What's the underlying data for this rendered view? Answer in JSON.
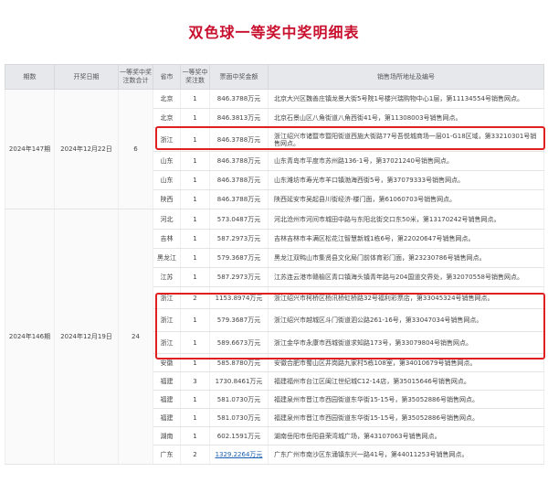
{
  "title": "双色球一等奖中奖明细表",
  "headers": {
    "period": "期数",
    "date": "开奖日期",
    "total": "一等奖中奖注数合计",
    "province": "省市",
    "count": "一等奖中奖注数",
    "amount": "票面中奖金额",
    "address": "销售场所地址及编号"
  },
  "groups": [
    {
      "period": "2024年147期",
      "date": "2024年12月22日",
      "total": "6",
      "rows": [
        {
          "province": "北京",
          "count": "1",
          "amount": "846.3788万元",
          "address": "北京大兴区魏善庄镇龙景大街5号院1号楼兴瑞购物中心1层，第11134554号销售网点。"
        },
        {
          "province": "北京",
          "count": "1",
          "amount": "846.3813万元",
          "address": "北京石景山区八角街道八角西街41号，第11308003号销售网点。"
        },
        {
          "province": "浙江",
          "count": "1",
          "amount": "846.3788万元",
          "address": "浙江绍兴市诸暨市暨阳街道西施大街路77号吾悦城商场一层01-G18区域，第33210301号销售网点。"
        },
        {
          "province": "山东",
          "count": "1",
          "amount": "846.3788万元",
          "address": "山东青岛市平度市苏州路136-1号，第37021240号销售网点。"
        },
        {
          "province": "山东",
          "count": "1",
          "amount": "846.3788万元",
          "address": "山东潍坊市寿光市羊口镇渤海西街5号，第37079333号销售网点。"
        },
        {
          "province": "陕西",
          "count": "1",
          "amount": "846.3788万元",
          "address": "陕西延安市吴起县川街经济-楼门面，第61060703号销售网点。"
        }
      ]
    },
    {
      "period": "2024年146期",
      "date": "2024年12月19日",
      "total": "24",
      "rows": [
        {
          "province": "河北",
          "count": "1",
          "amount": "573.0487万元",
          "address": "河北沧州市河间市城田中路与东阳北街交口东50米，第13170242号销售网点。"
        },
        {
          "province": "吉林",
          "count": "1",
          "amount": "587.2973万元",
          "address": "吉林吉林市丰满区松花江智慧新城1栋6号，第22020647号销售网点。"
        },
        {
          "province": "黑龙江",
          "count": "1",
          "amount": "579.3687万元",
          "address": "黑龙江双鸭山市集贤县文化局门前体育彩门面，第23230786号销售网点。"
        },
        {
          "province": "江苏",
          "count": "1",
          "amount": "587.2973万元",
          "address": "江苏连云港市赣榆区青口镇海头镇青年路与204国道交界处，第32070558号销售网点。"
        },
        {
          "province": "浙江",
          "count": "2",
          "amount": "1153.8974万元",
          "address": "浙江绍兴市柯桥区杨汛桥虹桥路32号福利彩票店，第33045324号销售网点。"
        },
        {
          "province": "浙江",
          "count": "1",
          "amount": "579.3687万元",
          "address": "浙江绍兴市越城区斗门街道泗公路261-16号，第33047034号销售网点。"
        },
        {
          "province": "浙江",
          "count": "1",
          "amount": "589.6673万元",
          "address": "浙江金华市永康市西城街道求知路173号，第33079804号销售网点。"
        },
        {
          "province": "安徽",
          "count": "1",
          "amount": "585.8780万元",
          "address": "安徽合肥市蜀山区井岗路九家村5栋108室，第34010679号销售网点。"
        },
        {
          "province": "福建",
          "count": "3",
          "amount": "1730.8461万元",
          "address": "福建福州市台江区闽江世纪城C12-14店，第35015646号销售网点。"
        },
        {
          "province": "福建",
          "count": "1",
          "amount": "581.0730万元",
          "address": "福建泉州市晋江市西园街道东华街15-15号，第35052886号销售网点。"
        },
        {
          "province": "福建",
          "count": "1",
          "amount": "581.0730万元",
          "address": "福建泉州市晋江市西园街道东华街15-15号，第35052886号销售网点。"
        },
        {
          "province": "湖南",
          "count": "1",
          "amount": "602.1591万元",
          "address": "湖南岳阳市岳阳县荣湾城广场，第43107063号销售网点。"
        },
        {
          "province": "广东",
          "count": "2",
          "amount": "1329.2264万元",
          "address": "广东广州市南沙区东涌镇东兴一路41号，第44011253号销售网点。",
          "link": true
        }
      ]
    }
  ]
}
